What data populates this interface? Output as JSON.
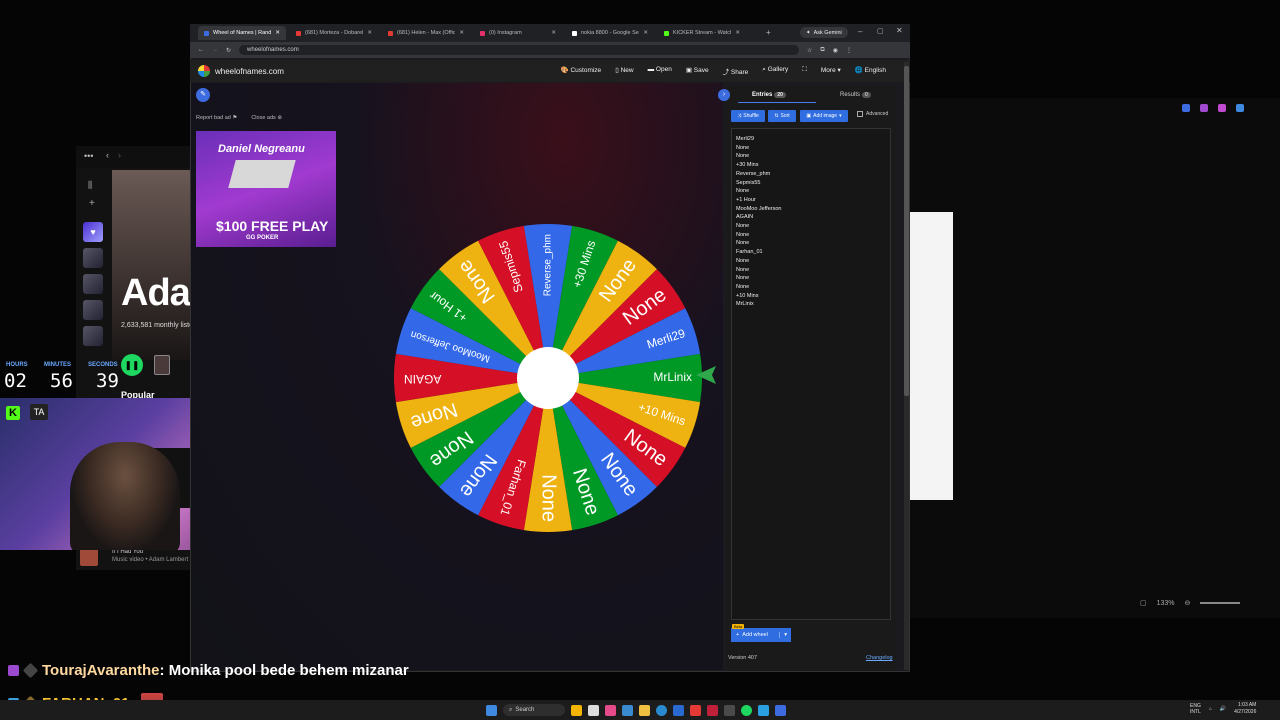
{
  "browser": {
    "tabs": [
      {
        "label": "Wheel of Names | Rando",
        "color": "#3d6be0",
        "active": true
      },
      {
        "label": "(681) Morteza - Dobareh Ev",
        "color": "#e53935"
      },
      {
        "label": "(681) Helen - Max (Official V",
        "color": "#e53935"
      },
      {
        "label": "(0) Instagram",
        "color": "#e1306c"
      },
      {
        "label": "nokia 8800 - Google Search",
        "color": "#ffffff"
      },
      {
        "label": "KICKER Stream - Watch Live",
        "color": "#53fc18"
      }
    ],
    "gemini": "Ask Gemini",
    "url": "wheelofnames.com"
  },
  "app": {
    "brand": "wheelofnames.com",
    "menu": [
      "Customize",
      "New",
      "Open",
      "Save",
      "Share",
      "Gallery",
      "More",
      "English"
    ],
    "report_ad": "Report bad ad",
    "close_ads": "Close ads",
    "ad": {
      "name": "Daniel Negreanu",
      "offer": "$100 FREE PLAY",
      "brand": "GG POKER"
    },
    "tabs": {
      "entries": "Entries",
      "entries_count": "20",
      "results": "Results",
      "results_count": "0"
    },
    "buttons": {
      "shuffle": "Shuffle",
      "sort": "Sort",
      "add_image": "Add image",
      "advanced": "Advanced"
    },
    "entries": [
      "Merli29",
      "None",
      "None",
      "+30 Mins",
      "Reverse_phm",
      "Sepmis55",
      "None",
      "+1 Hour",
      "MooMoo Jefferson",
      "AGAIN",
      "None",
      "None",
      "None",
      "Farhan_01",
      "None",
      "None",
      "None",
      "None",
      "+10 Mins",
      "MrLinix"
    ],
    "beta": "Beta",
    "add_wheel": "Add wheel",
    "version": "Version 407",
    "changelog": "Changelog"
  },
  "wheel": {
    "slices": [
      "Merli29",
      "MrLinix",
      "+10 Mins",
      "None",
      "None",
      "None",
      "None",
      "Farhan_01",
      "None",
      "None",
      "None",
      "AGAIN",
      "MooMoo Jefferson",
      "+1 Hour",
      "None",
      "Sepmis55",
      "Reverse_phm",
      "+30 Mins",
      "None",
      "None"
    ],
    "colors": [
      "#3369e8",
      "#009925",
      "#eeb211",
      "#d50f25"
    ]
  },
  "spotify": {
    "artist": "Ada",
    "listeners": "2,633,581 monthly liste",
    "section": "Popular",
    "track": "If I Had You",
    "track_sub": "Music video • Adam Lambert"
  },
  "timer": {
    "hours_label": "HOURS",
    "hours": "02",
    "minutes_label": "MINUTES",
    "minutes": "56",
    "seconds_label": "SECONDS",
    "seconds": "39"
  },
  "chat": [
    {
      "user": "TourajAvaranthe",
      "user_color": "#ffd9a0",
      "message": " : Monika pool bede behem mizanar"
    },
    {
      "user": "FARHAN_01",
      "user_color": "#f4c430",
      "message": " :"
    }
  ],
  "taskbar": {
    "search": "Search",
    "lang": "ENG",
    "lang_sub": "INTL",
    "time": "1:03 AM",
    "date": "4/27/2026"
  },
  "right_window": {
    "zoom": "133%"
  }
}
